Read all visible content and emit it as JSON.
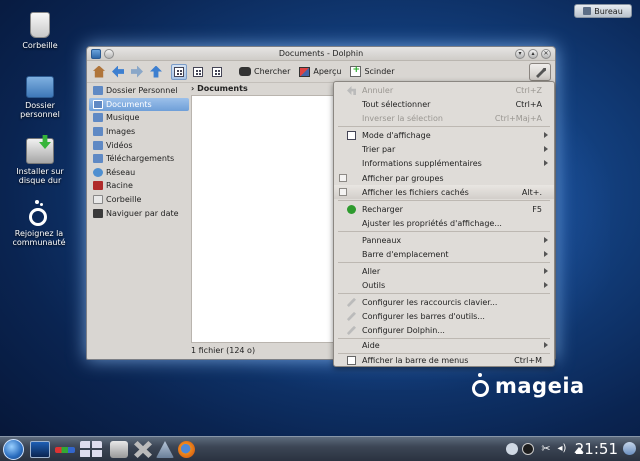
{
  "desktop": {
    "bureau_label": "Bureau",
    "icons": [
      {
        "label": "Corbeille",
        "icon": "trash-icon"
      },
      {
        "label": "Dossier personnel",
        "icon": "home-folder-icon"
      },
      {
        "label": "Installer sur disque dur",
        "icon": "install-icon"
      },
      {
        "label": "Rejoignez la communauté",
        "icon": "mageia-community-icon"
      }
    ],
    "logo_text": "mageia"
  },
  "window": {
    "title": "Documents - Dolphin",
    "toolbar": {
      "search_label": "Chercher",
      "preview_label": "Aperçu",
      "split_label": "Scinder"
    },
    "places": [
      {
        "label": "Dossier Personnel",
        "color": "#5f89c4"
      },
      {
        "label": "Documents",
        "color": "#5f89c4"
      },
      {
        "label": "Musique",
        "color": "#5f89c4"
      },
      {
        "label": "Images",
        "color": "#5f89c4"
      },
      {
        "label": "Vidéos",
        "color": "#5f89c4"
      },
      {
        "label": "Téléchargements",
        "color": "#5f89c4"
      },
      {
        "label": "Réseau",
        "color": "#4f8fd0"
      },
      {
        "label": "Racine",
        "color": "#b02a2a"
      },
      {
        "label": "Corbeille",
        "color": "#e8e8e8"
      },
      {
        "label": "Naviguer par date",
        "color": "#3a3a3a"
      }
    ],
    "selected_place": "Documents",
    "breadcrumb": "Documents",
    "status": "1 fichier (124 o)"
  },
  "menu": {
    "items": {
      "undo": {
        "label": "Annuler",
        "shortcut": "Ctrl+Z"
      },
      "select_all": {
        "label": "Tout sélectionner",
        "shortcut": "Ctrl+A"
      },
      "invert": {
        "label": "Inverser la sélection",
        "shortcut": "Ctrl+Maj+A"
      },
      "view_mode": {
        "label": "Mode d'affichage"
      },
      "sort_by": {
        "label": "Trier par"
      },
      "more_info": {
        "label": "Informations supplémentaires"
      },
      "show_groups": {
        "label": "Afficher par groupes"
      },
      "show_hidden": {
        "label": "Afficher les fichiers cachés",
        "shortcut": "Alt+."
      },
      "reload": {
        "label": "Recharger",
        "shortcut": "F5"
      },
      "adjust_view": {
        "label": "Ajuster les propriétés d'affichage..."
      },
      "panels": {
        "label": "Panneaux"
      },
      "location_bar": {
        "label": "Barre d'emplacement"
      },
      "go": {
        "label": "Aller"
      },
      "tools": {
        "label": "Outils"
      },
      "shortcuts": {
        "label": "Configurer les raccourcis clavier..."
      },
      "toolbars": {
        "label": "Configurer les barres d'outils..."
      },
      "configure": {
        "label": "Configurer Dolphin..."
      },
      "help": {
        "label": "Aide"
      },
      "menubar": {
        "label": "Afficher la barre de menus",
        "shortcut": "Ctrl+M"
      }
    }
  },
  "taskbar": {
    "clock": "21:51"
  }
}
